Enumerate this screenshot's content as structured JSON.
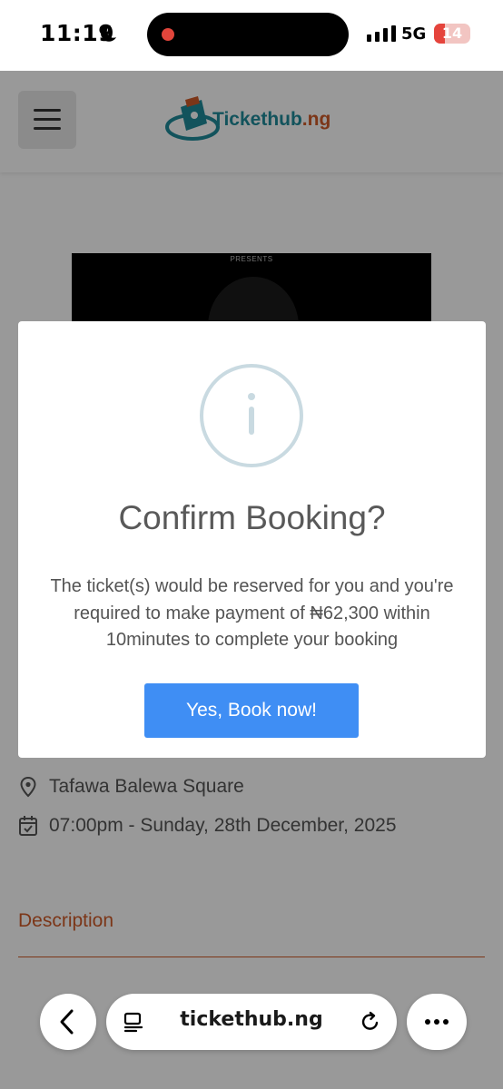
{
  "status_bar": {
    "time": "11:19",
    "network": "5G",
    "battery_level": "14",
    "battery_fraction": 0.14,
    "icons": [
      "moon-icon",
      "signal-icon",
      "battery-icon"
    ]
  },
  "site": {
    "logo_text_main": "Tickethub",
    "logo_text_suffix": ".ng",
    "menu_icon": "hamburger-icon",
    "brand_colors": {
      "teal": "#1f8a9a",
      "orange": "#cf5a28"
    }
  },
  "event": {
    "poster_caption": "PRESENTS",
    "venue": "Tafawa Balewa Square",
    "datetime": "07:00pm - Sunday, 28th December, 2025",
    "description_label": "Description"
  },
  "modal": {
    "icon": "info-icon",
    "title": "Confirm Booking?",
    "message": "The ticket(s) would be reserved for you and you're required to make payment of ₦62,300 within 10minutes to complete your booking",
    "confirm_label": "Yes, Book now!",
    "confirm_color": "#3f8ef4"
  },
  "browser": {
    "url": "tickethub.ng",
    "icons": [
      "back-icon",
      "reader-icon",
      "reload-icon",
      "more-icon"
    ]
  }
}
